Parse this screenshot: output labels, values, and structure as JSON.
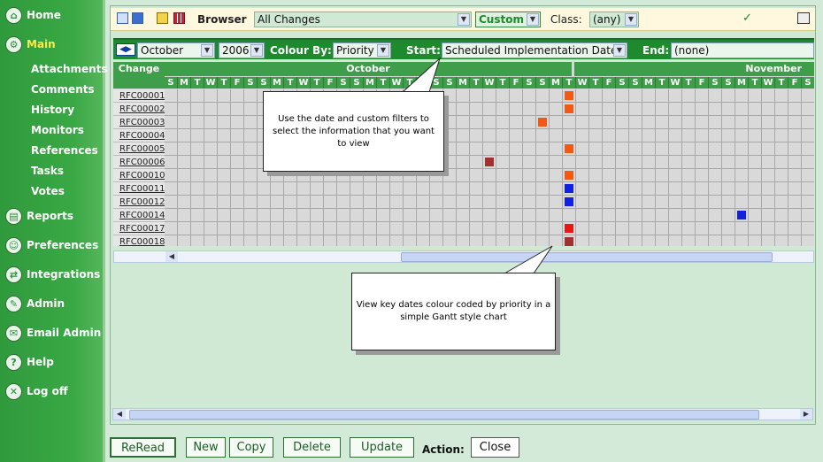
{
  "sidebar": {
    "items": [
      {
        "label": "Home",
        "icon": "home-icon"
      },
      {
        "label": "Main",
        "icon": "main-icon",
        "active": true
      },
      {
        "label": "Reports",
        "icon": "reports-icon"
      },
      {
        "label": "Preferences",
        "icon": "preferences-icon"
      },
      {
        "label": "Integrations",
        "icon": "integrations-icon"
      },
      {
        "label": "Admin",
        "icon": "admin-icon"
      },
      {
        "label": "Email Admin",
        "icon": "email-icon"
      },
      {
        "label": "Help",
        "icon": "help-icon"
      },
      {
        "label": "Log off",
        "icon": "logoff-icon"
      }
    ],
    "sub_items": [
      "Attachments",
      "Comments",
      "History",
      "Monitors",
      "References",
      "Tasks",
      "Votes"
    ]
  },
  "toolbar": {
    "browser_label": "Browser",
    "view_value": "All Changes",
    "custom_label": "Custom",
    "class_label": "Class:",
    "class_value": "(any)"
  },
  "filters": {
    "month": "October",
    "year": "2006",
    "colour_by_label": "Colour By:",
    "colour_by_value": "Priority",
    "start_label": "Start:",
    "start_value": "Scheduled Implementation Date",
    "end_label": "End:",
    "end_value": "(none)"
  },
  "grid": {
    "change_header": "Change",
    "month1": "October",
    "month2": "November",
    "day_letters": [
      "S",
      "M",
      "T",
      "W",
      "T",
      "F",
      "S",
      "S",
      "M",
      "T",
      "W",
      "T",
      "F",
      "S",
      "S",
      "M",
      "T",
      "W",
      "T",
      "F",
      "S",
      "S",
      "M",
      "T",
      "W",
      "T",
      "F",
      "S",
      "S",
      "M",
      "T",
      "W",
      "T",
      "F",
      "S",
      "S",
      "M",
      "T",
      "W",
      "T",
      "F",
      "S",
      "S",
      "M",
      "T",
      "W",
      "T",
      "F",
      "S",
      "S"
    ],
    "rows": [
      "RFC00001",
      "RFC00002",
      "RFC00003",
      "RFC00004",
      "RFC00005",
      "RFC00006",
      "RFC00010",
      "RFC00011",
      "RFC00012",
      "RFC00014",
      "RFC00017",
      "RFC00018"
    ],
    "marks": [
      {
        "row": 0,
        "day": 30,
        "color": "#f05a14"
      },
      {
        "row": 1,
        "day": 30,
        "color": "#f05a14"
      },
      {
        "row": 2,
        "day": 28,
        "color": "#f05a14"
      },
      {
        "row": 4,
        "day": 30,
        "color": "#f05a14"
      },
      {
        "row": 5,
        "day": 24,
        "color": "#a33030"
      },
      {
        "row": 6,
        "day": 30,
        "color": "#f05a14"
      },
      {
        "row": 7,
        "day": 30,
        "color": "#1022e0"
      },
      {
        "row": 8,
        "day": 30,
        "color": "#1022e0"
      },
      {
        "row": 9,
        "day": 43,
        "color": "#1022e0"
      },
      {
        "row": 10,
        "day": 30,
        "color": "#e01a14"
      },
      {
        "row": 11,
        "day": 30,
        "color": "#a33030"
      }
    ]
  },
  "callouts": {
    "filters_tip": "Use the date and custom filters to select the information that you want to view",
    "gantt_tip": "View key dates colour coded by priority in a simple Gantt style chart"
  },
  "buttons": {
    "reread": "ReRead",
    "new": "New",
    "copy": "Copy",
    "delete": "Delete",
    "update": "Update",
    "action_label": "Action:",
    "close": "Close"
  }
}
